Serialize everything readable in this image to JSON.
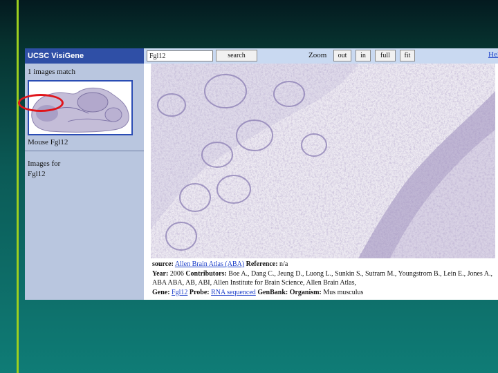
{
  "app": {
    "brand": "UCSC VisiGene"
  },
  "toolbar": {
    "search_value": "Fgl12",
    "search_button": "search",
    "zoom_label": "Zoom",
    "zoom_in_button": "in",
    "zoom_out_button": "out",
    "zoom_full_button": "full",
    "zoom_fit_button": "fit",
    "help_link": "Help"
  },
  "sidebar": {
    "match_count": "1 images match",
    "thumb_caption": "Mouse Fgl12",
    "images_for_label": "Images for",
    "images_for_gene": "Fgl12"
  },
  "info": {
    "source_label": "source:",
    "source_value": "Allen Brain Atlas (ABA)",
    "reference_label": "Reference:",
    "reference_value": "n/a",
    "year_label": "Year:",
    "year_value": "2006",
    "contributors_label": "Contributors:",
    "contributors_value": "Boe A., Dang C., Jeung D., Luong L., Sunkin S., Sutram M., Youngstrom B., Lein E., Jones A., ABA ABA, AB, ABI, Allen Institute for Brain Science, Allen Brain Atlas,",
    "gene_label": "Gene:",
    "gene_value": "Fgl12",
    "probe_label": "Probe:",
    "probe_value": "RNA sequenced",
    "genbank_label": "GenBank:",
    "organism_label": "Organism:",
    "organism_value": "Mus musculus"
  },
  "colors": {
    "brand_bar": "#2f4fa6",
    "toolbar": "#c9d9f1",
    "sidebar": "#b9c6df",
    "annotation_oval": "#e0141a",
    "slide_accent": "#9ccf1f"
  }
}
